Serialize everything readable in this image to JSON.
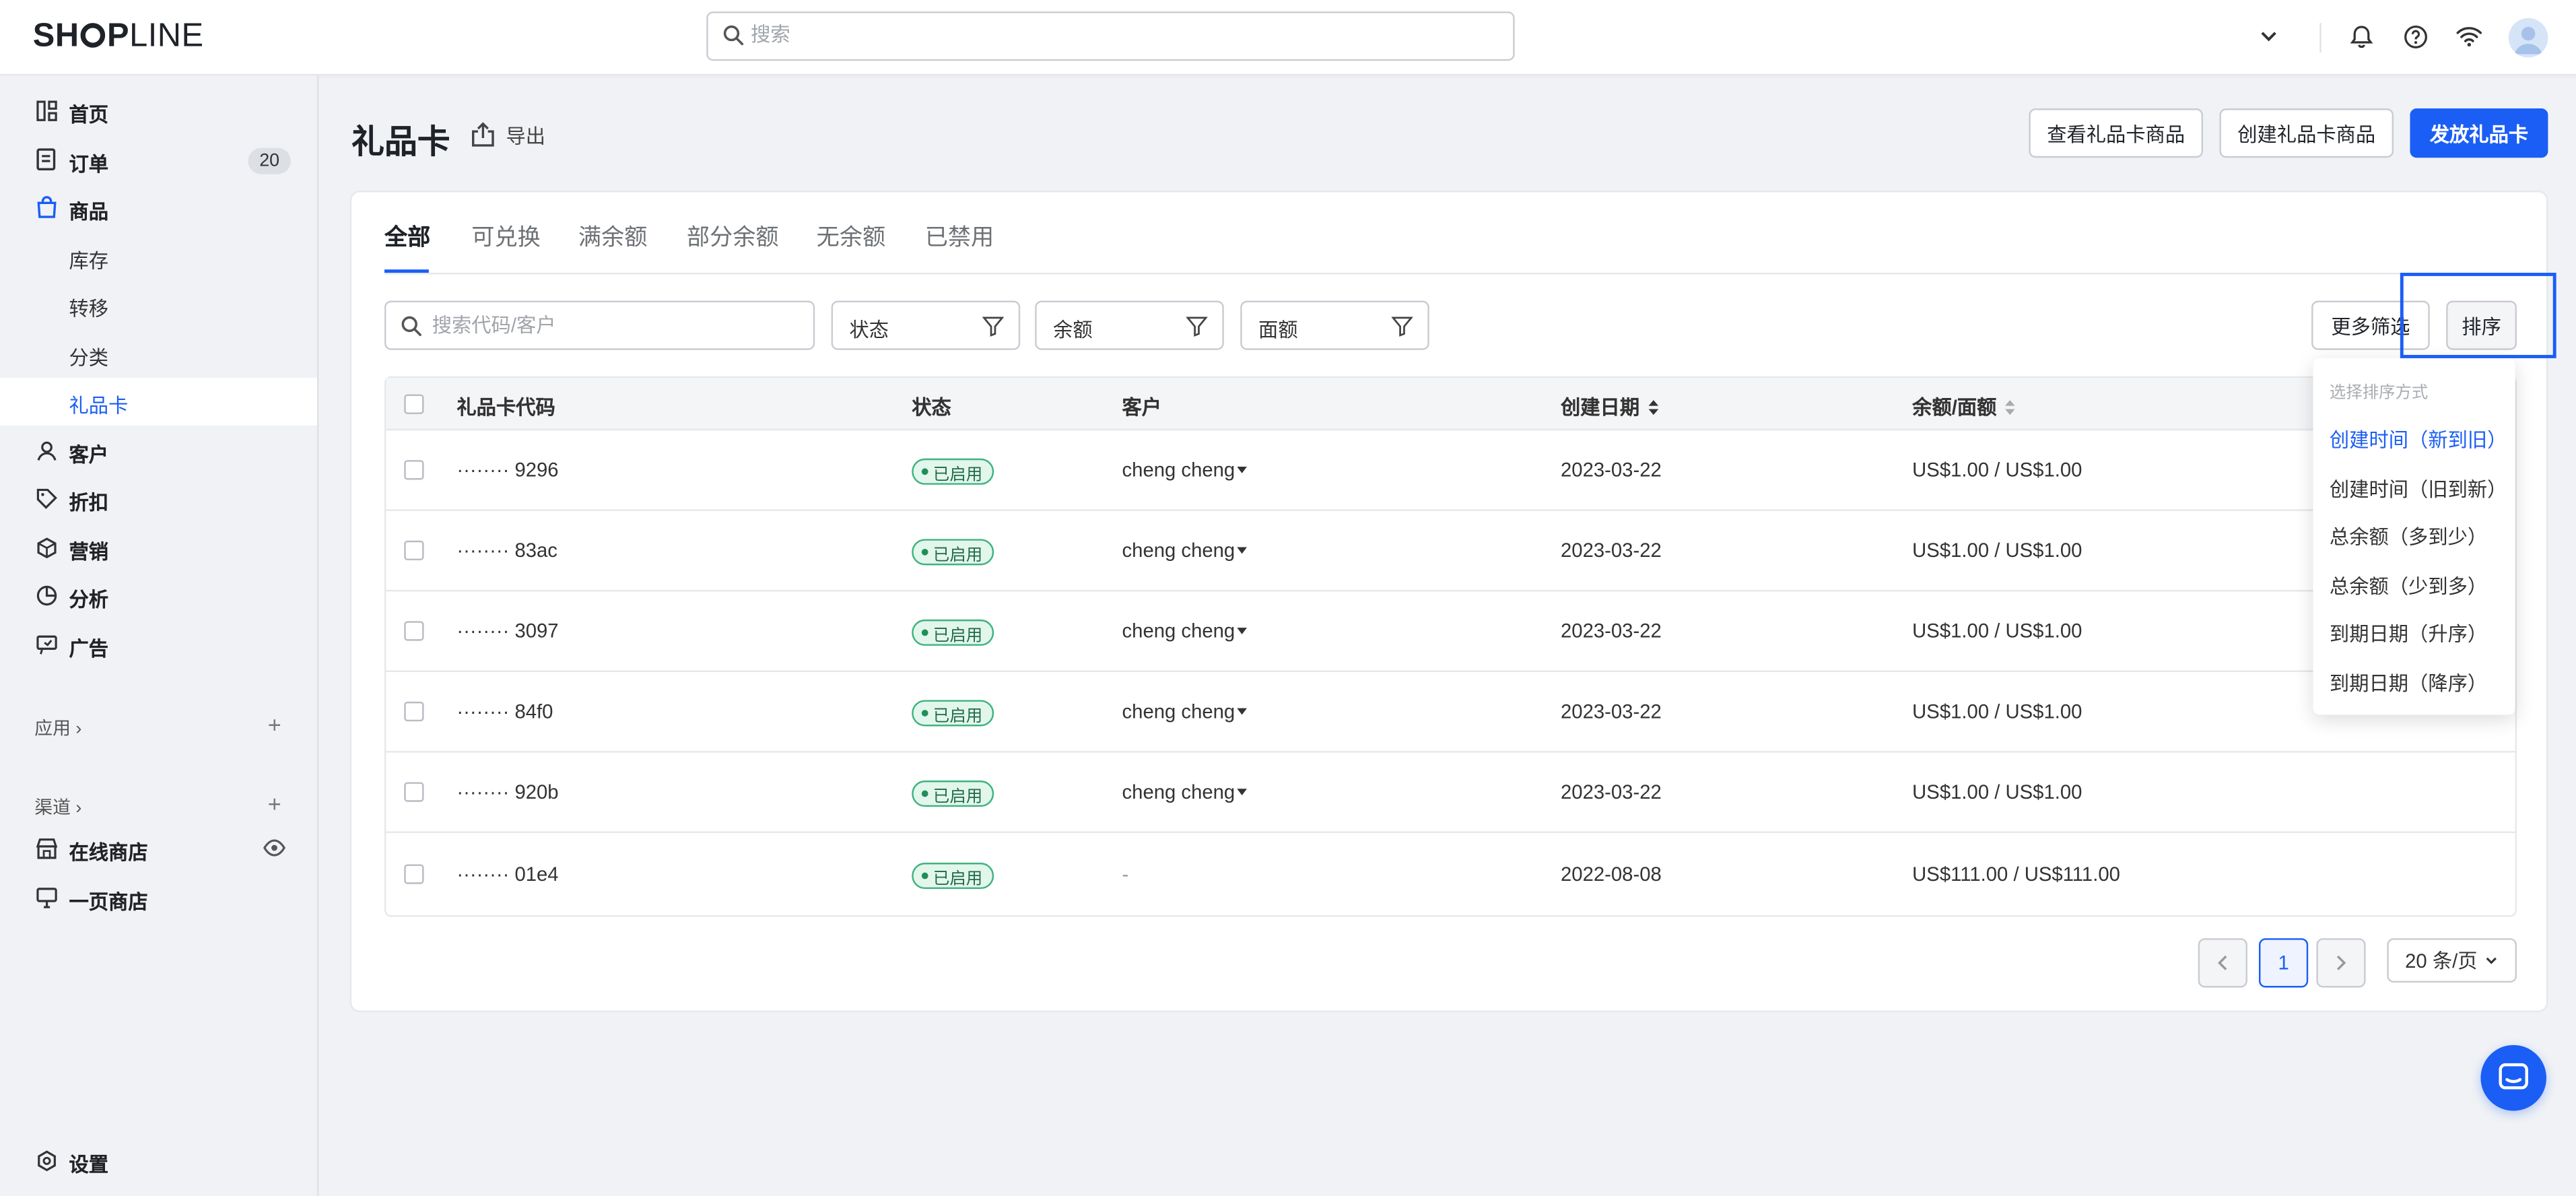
{
  "brand": {
    "logo_left": "SH",
    "logo_bold_right": "P",
    "logo_thin": "LINE"
  },
  "topbar": {
    "search_placeholder": "搜索"
  },
  "sidebar": {
    "items": [
      {
        "label": "首页",
        "icon": "dashboard-icon"
      },
      {
        "label": "订单",
        "icon": "order-icon",
        "badge": "20"
      },
      {
        "label": "商品",
        "icon": "bag-icon"
      },
      {
        "label": "库存"
      },
      {
        "label": "转移"
      },
      {
        "label": "分类"
      },
      {
        "label": "礼品卡"
      },
      {
        "label": "客户",
        "icon": "user-icon"
      },
      {
        "label": "折扣",
        "icon": "tag-icon"
      },
      {
        "label": "营销",
        "icon": "marketing-icon"
      },
      {
        "label": "分析",
        "icon": "analytics-icon"
      },
      {
        "label": "广告",
        "icon": "ads-icon"
      }
    ],
    "apps_label": "应用",
    "channels_label": "渠道",
    "channels": [
      {
        "label": "在线商店",
        "icon": "store-icon"
      },
      {
        "label": "一页商店",
        "icon": "page-store-icon"
      }
    ],
    "settings_label": "设置"
  },
  "page": {
    "title": "礼品卡",
    "export_label": "导出",
    "actions": {
      "view_products": "查看礼品卡商品",
      "create_product": "创建礼品卡商品",
      "issue": "发放礼品卡"
    }
  },
  "tabs": [
    "全部",
    "可兑换",
    "满余额",
    "部分余额",
    "无余额",
    "已禁用"
  ],
  "filters": {
    "search_placeholder": "搜索代码/客户",
    "status": "状态",
    "balance": "余额",
    "face_value": "面额",
    "more": "更多筛选",
    "sort": "排序"
  },
  "table": {
    "headers": {
      "code": "礼品卡代码",
      "status": "状态",
      "customer": "客户",
      "created": "创建日期",
      "balance": "余额/面额"
    },
    "rows": [
      {
        "code": "········ 9296",
        "status": "已启用",
        "customer": "cheng cheng",
        "created": "2023-03-22",
        "balance": "US$1.00 / US$1.00"
      },
      {
        "code": "········ 83ac",
        "status": "已启用",
        "customer": "cheng cheng",
        "created": "2023-03-22",
        "balance": "US$1.00 / US$1.00"
      },
      {
        "code": "········ 3097",
        "status": "已启用",
        "customer": "cheng cheng",
        "created": "2023-03-22",
        "balance": "US$1.00 / US$1.00"
      },
      {
        "code": "········ 84f0",
        "status": "已启用",
        "customer": "cheng cheng",
        "created": "2023-03-22",
        "balance": "US$1.00 / US$1.00"
      },
      {
        "code": "········ 920b",
        "status": "已启用",
        "customer": "cheng cheng",
        "created": "2023-03-22",
        "balance": "US$1.00 / US$1.00"
      },
      {
        "code": "········ 01e4",
        "status": "已启用",
        "customer": "-",
        "created": "2022-08-08",
        "balance": "US$111.00 / US$111.00"
      }
    ]
  },
  "pagination": {
    "current": "1",
    "page_size": "20 条/页"
  },
  "sort_menu": {
    "title": "选择排序方式",
    "options": [
      "创建时间（新到旧）",
      "创建时间（旧到新）",
      "总余额（多到少）",
      "总余额（少到多）",
      "到期日期（升序）",
      "到期日期（降序）"
    ],
    "selected_index": 0
  },
  "colors": {
    "accent": "#1b5ef5",
    "status_bg": "#e3f6ec",
    "status_border": "#3fb37f"
  }
}
